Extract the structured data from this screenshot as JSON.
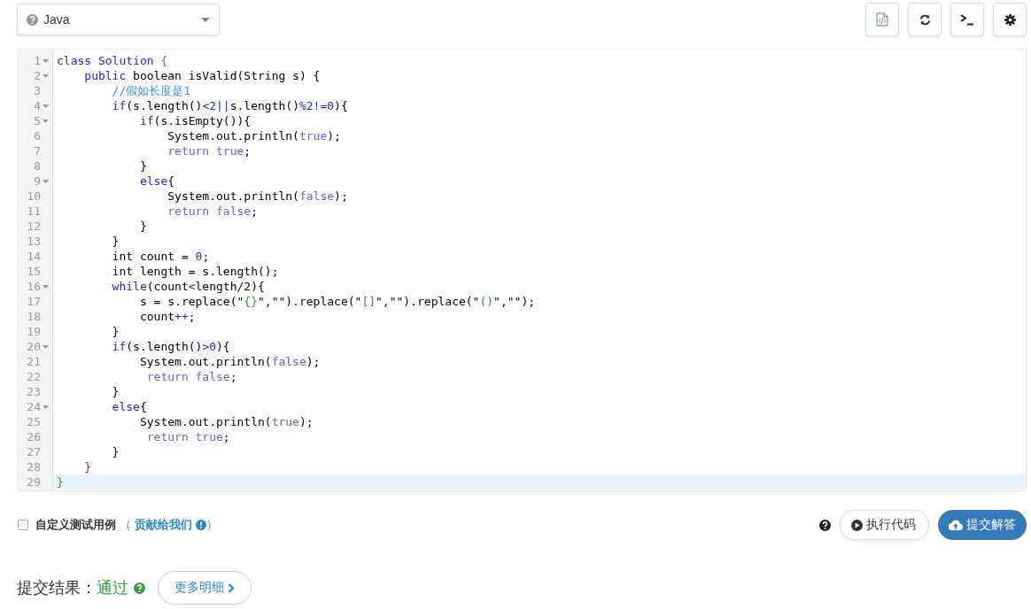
{
  "language_select": {
    "value": "Java"
  },
  "editor": {
    "lines": [
      {
        "number": "1",
        "foldable": true,
        "selected": false,
        "tokens": [
          {
            "text": "class ",
            "kind": "kw"
          },
          {
            "text": "Solution ",
            "kind": "kw"
          },
          {
            "text": "{",
            "kind": "green"
          }
        ]
      },
      {
        "number": "2",
        "foldable": true,
        "selected": false,
        "tokens": [
          {
            "text": "    public",
            "kind": "kw"
          },
          {
            "text": " boolean isValid(String s) {",
            "kind": "plain"
          }
        ]
      },
      {
        "number": "3",
        "foldable": false,
        "selected": false,
        "tokens": [
          {
            "text": "        //假如长度是1",
            "kind": "comment"
          }
        ]
      },
      {
        "number": "4",
        "foldable": true,
        "selected": false,
        "tokens": [
          {
            "text": "        if",
            "kind": "kw"
          },
          {
            "text": "(s.length()",
            "kind": "plain"
          },
          {
            "text": "<2||",
            "kind": "kw"
          },
          {
            "text": "s.length()",
            "kind": "plain"
          },
          {
            "text": "%2!=0",
            "kind": "kw"
          },
          {
            "text": "){",
            "kind": "plain"
          }
        ]
      },
      {
        "number": "5",
        "foldable": true,
        "selected": false,
        "tokens": [
          {
            "text": "            if",
            "kind": "kw"
          },
          {
            "text": "(s.isEmpty()){",
            "kind": "plain"
          }
        ]
      },
      {
        "number": "6",
        "foldable": false,
        "selected": false,
        "tokens": [
          {
            "text": "                System.out.println(",
            "kind": "plain"
          },
          {
            "text": "true",
            "kind": "atom"
          },
          {
            "text": ");",
            "kind": "plain"
          }
        ]
      },
      {
        "number": "7",
        "foldable": false,
        "selected": false,
        "tokens": [
          {
            "text": "                return true",
            "kind": "atom"
          },
          {
            "text": ";",
            "kind": "plain"
          }
        ]
      },
      {
        "number": "8",
        "foldable": false,
        "selected": false,
        "tokens": [
          {
            "text": "            }",
            "kind": "plain"
          }
        ]
      },
      {
        "number": "9",
        "foldable": true,
        "selected": false,
        "tokens": [
          {
            "text": "            else",
            "kind": "kw"
          },
          {
            "text": "{",
            "kind": "plain"
          }
        ]
      },
      {
        "number": "10",
        "foldable": false,
        "selected": false,
        "tokens": [
          {
            "text": "                System.out.println(",
            "kind": "plain"
          },
          {
            "text": "false",
            "kind": "atom"
          },
          {
            "text": ");",
            "kind": "plain"
          }
        ]
      },
      {
        "number": "11",
        "foldable": false,
        "selected": false,
        "tokens": [
          {
            "text": "                return false",
            "kind": "atom"
          },
          {
            "text": ";",
            "kind": "plain"
          }
        ]
      },
      {
        "number": "12",
        "foldable": false,
        "selected": false,
        "tokens": [
          {
            "text": "            }",
            "kind": "plain"
          }
        ]
      },
      {
        "number": "13",
        "foldable": false,
        "selected": false,
        "tokens": [
          {
            "text": "        }",
            "kind": "plain"
          }
        ]
      },
      {
        "number": "14",
        "foldable": false,
        "selected": false,
        "tokens": [
          {
            "text": "        int count = ",
            "kind": "plain"
          },
          {
            "text": "0",
            "kind": "kw"
          },
          {
            "text": ";",
            "kind": "plain"
          }
        ]
      },
      {
        "number": "15",
        "foldable": false,
        "selected": false,
        "tokens": [
          {
            "text": "        int length = s.length();",
            "kind": "plain"
          }
        ]
      },
      {
        "number": "16",
        "foldable": true,
        "selected": false,
        "tokens": [
          {
            "text": "        while",
            "kind": "kw"
          },
          {
            "text": "(count",
            "kind": "plain"
          },
          {
            "text": "<",
            "kind": "kw"
          },
          {
            "text": "length/2){",
            "kind": "plain"
          }
        ]
      },
      {
        "number": "17",
        "foldable": false,
        "selected": false,
        "tokens": [
          {
            "text": "            s = s.replace(\"",
            "kind": "plain"
          },
          {
            "text": "{}",
            "kind": "green"
          },
          {
            "text": "\",\"\").replace(\"",
            "kind": "plain"
          },
          {
            "text": "[]",
            "kind": "green"
          },
          {
            "text": "\",\"\").replace(\"",
            "kind": "plain"
          },
          {
            "text": "()",
            "kind": "green"
          },
          {
            "text": "\",\"\");",
            "kind": "plain"
          }
        ]
      },
      {
        "number": "18",
        "foldable": false,
        "selected": false,
        "tokens": [
          {
            "text": "            count",
            "kind": "plain"
          },
          {
            "text": "++",
            "kind": "kw"
          },
          {
            "text": ";",
            "kind": "plain"
          }
        ]
      },
      {
        "number": "19",
        "foldable": false,
        "selected": false,
        "tokens": [
          {
            "text": "        }",
            "kind": "plain"
          }
        ]
      },
      {
        "number": "20",
        "foldable": true,
        "selected": false,
        "tokens": [
          {
            "text": "        if",
            "kind": "kw"
          },
          {
            "text": "(s.length()",
            "kind": "plain"
          },
          {
            "text": ">0",
            "kind": "kw"
          },
          {
            "text": "){",
            "kind": "plain"
          }
        ]
      },
      {
        "number": "21",
        "foldable": false,
        "selected": false,
        "tokens": [
          {
            "text": "            System.out.println(",
            "kind": "plain"
          },
          {
            "text": "false",
            "kind": "atom"
          },
          {
            "text": ");",
            "kind": "plain"
          }
        ]
      },
      {
        "number": "22",
        "foldable": false,
        "selected": false,
        "tokens": [
          {
            "text": "             return false",
            "kind": "atom"
          },
          {
            "text": ";",
            "kind": "plain"
          }
        ]
      },
      {
        "number": "23",
        "foldable": false,
        "selected": false,
        "tokens": [
          {
            "text": "        }",
            "kind": "plain"
          }
        ]
      },
      {
        "number": "24",
        "foldable": true,
        "selected": false,
        "tokens": [
          {
            "text": "        else",
            "kind": "kw"
          },
          {
            "text": "{",
            "kind": "plain"
          }
        ]
      },
      {
        "number": "25",
        "foldable": false,
        "selected": false,
        "tokens": [
          {
            "text": "            System.out.println(",
            "kind": "plain"
          },
          {
            "text": "true",
            "kind": "atom"
          },
          {
            "text": ");",
            "kind": "plain"
          }
        ]
      },
      {
        "number": "26",
        "foldable": false,
        "selected": false,
        "tokens": [
          {
            "text": "             return true",
            "kind": "atom"
          },
          {
            "text": ";",
            "kind": "plain"
          }
        ]
      },
      {
        "number": "27",
        "foldable": false,
        "selected": false,
        "tokens": [
          {
            "text": "        }",
            "kind": "plain"
          }
        ]
      },
      {
        "number": "28",
        "foldable": false,
        "selected": false,
        "tokens": [
          {
            "text": "    }",
            "kind": "purple"
          }
        ]
      },
      {
        "number": "29",
        "foldable": false,
        "selected": true,
        "tokens": [
          {
            "text": "}",
            "kind": "green"
          }
        ]
      }
    ]
  },
  "custom_test": {
    "checked": false,
    "label": "自定义测试用例",
    "open_paren": "（",
    "link": "贡献给我们",
    "close_paren": "）"
  },
  "run_button": "执行代码",
  "submit_button": "提交解答",
  "result": {
    "label": "提交结果：",
    "status": "通过",
    "details_button": "更多明细"
  }
}
